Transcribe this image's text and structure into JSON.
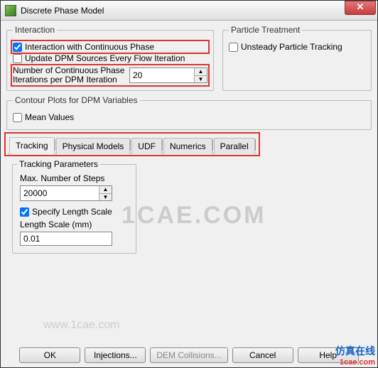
{
  "window": {
    "title": "Discrete Phase Model"
  },
  "interaction": {
    "legend": "Interaction",
    "chk_continuous": {
      "label": "Interaction with Continuous Phase",
      "checked": true
    },
    "chk_update": {
      "label": "Update DPM Sources Every Flow Iteration",
      "checked": false
    },
    "spin": {
      "label": "Number of Continuous Phase Iterations per DPM Iteration",
      "value": "20"
    }
  },
  "particle": {
    "legend": "Particle Treatment",
    "chk_unsteady": {
      "label": "Unsteady Particle Tracking",
      "checked": false
    }
  },
  "contour": {
    "legend": "Contour Plots for DPM Variables",
    "chk_mean": {
      "label": "Mean Values",
      "checked": false
    }
  },
  "tabs": {
    "tracking": "Tracking",
    "physical": "Physical Models",
    "udf": "UDF",
    "numerics": "Numerics",
    "parallel": "Parallel"
  },
  "tracking_params": {
    "legend": "Tracking Parameters",
    "max_steps_label": "Max. Number of Steps",
    "max_steps_value": "20000",
    "chk_length": {
      "label": "Specify Length Scale",
      "checked": true
    },
    "length_label": "Length Scale (mm)",
    "length_value": "0.01"
  },
  "buttons": {
    "ok": "OK",
    "injections": "Injections...",
    "dem": "DEM Collisions...",
    "cancel": "Cancel",
    "help": "Help"
  },
  "watermarks": {
    "big": "1CAE.COM",
    "url": "www.1cae.com",
    "cn": "仿真在线",
    "cn2": "1cae.com"
  }
}
